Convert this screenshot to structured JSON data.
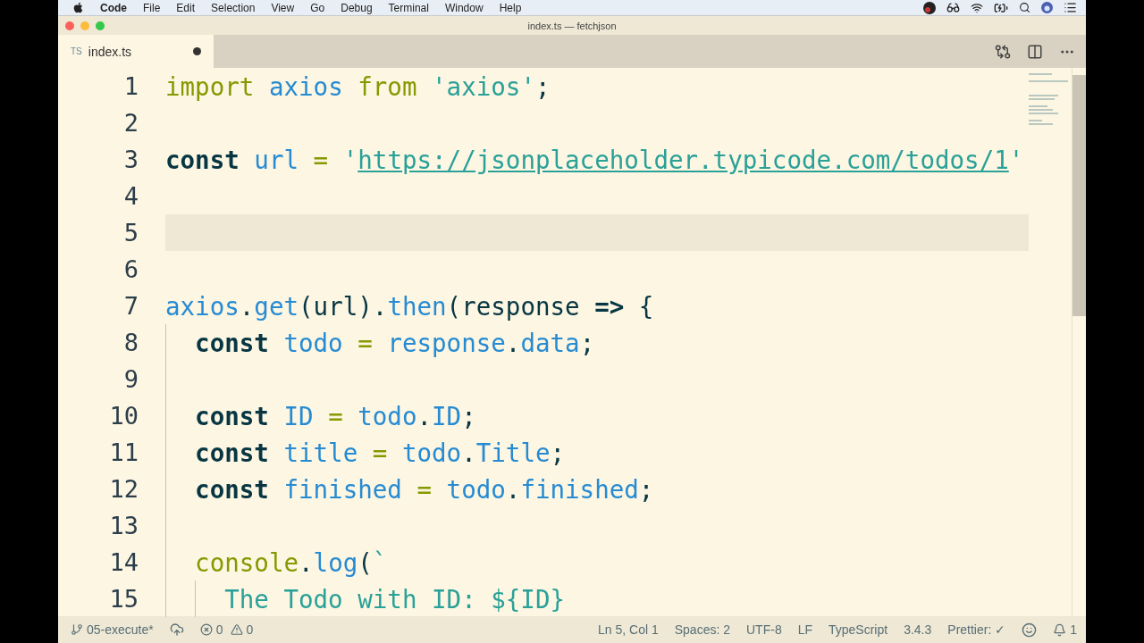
{
  "menubar": {
    "app": "Code",
    "menus": [
      "File",
      "Edit",
      "Selection",
      "View",
      "Go",
      "Debug",
      "Terminal",
      "Window",
      "Help"
    ]
  },
  "window": {
    "title": "index.ts — fetchjson"
  },
  "tabs": [
    {
      "badge": "TS",
      "label": "index.ts",
      "selected": true,
      "modified": true
    }
  ],
  "editor": {
    "lines": [
      {
        "number": "1",
        "highlighted": false,
        "tokens": [
          {
            "kind": "control",
            "text": "import "
          },
          {
            "kind": "variable",
            "text": "axios "
          },
          {
            "kind": "control",
            "text": "from "
          },
          {
            "kind": "string",
            "text": "'axios'"
          },
          {
            "kind": "plain",
            "text": ";"
          }
        ]
      },
      {
        "number": "2",
        "highlighted": false
      },
      {
        "number": "3",
        "highlighted": false,
        "tokens": [
          {
            "kind": "keyword",
            "text": "const "
          },
          {
            "kind": "variable",
            "text": "url "
          },
          {
            "kind": "operator",
            "text": "= "
          },
          {
            "kind": "string",
            "text": "'"
          },
          {
            "kind": "link",
            "text": "https://jsonplaceholder.typicode.com/todos/1"
          },
          {
            "kind": "string",
            "text": "'"
          }
        ]
      },
      {
        "number": "4",
        "highlighted": false
      },
      {
        "number": "5",
        "highlighted": true
      },
      {
        "number": "6",
        "highlighted": false
      },
      {
        "number": "7",
        "highlighted": false,
        "tokens": [
          {
            "kind": "variable",
            "text": "axios"
          },
          {
            "kind": "plain",
            "text": "."
          },
          {
            "kind": "variable",
            "text": "get"
          },
          {
            "kind": "plain",
            "text": "(url)."
          },
          {
            "kind": "variable",
            "text": "then"
          },
          {
            "kind": "plain",
            "text": "(response "
          },
          {
            "kind": "keyword",
            "text": "=> "
          },
          {
            "kind": "plain",
            "text": "{"
          }
        ]
      },
      {
        "number": "8",
        "highlighted": false,
        "tokens": [
          {
            "kind": "keyword",
            "text": "  const "
          },
          {
            "kind": "variable",
            "text": "todo "
          },
          {
            "kind": "operator",
            "text": "= "
          },
          {
            "kind": "variable",
            "text": "response"
          },
          {
            "kind": "plain",
            "text": "."
          },
          {
            "kind": "variable",
            "text": "data"
          },
          {
            "kind": "plain",
            "text": ";"
          }
        ]
      },
      {
        "number": "9",
        "highlighted": false
      },
      {
        "number": "10",
        "highlighted": false,
        "tokens": [
          {
            "kind": "keyword",
            "text": "  const "
          },
          {
            "kind": "variable",
            "text": "ID "
          },
          {
            "kind": "operator",
            "text": "= "
          },
          {
            "kind": "variable",
            "text": "todo"
          },
          {
            "kind": "plain",
            "text": "."
          },
          {
            "kind": "variable",
            "text": "ID"
          },
          {
            "kind": "plain",
            "text": ";"
          }
        ]
      },
      {
        "number": "11",
        "highlighted": false,
        "tokens": [
          {
            "kind": "keyword",
            "text": "  const "
          },
          {
            "kind": "variable",
            "text": "title "
          },
          {
            "kind": "operator",
            "text": "= "
          },
          {
            "kind": "variable",
            "text": "todo"
          },
          {
            "kind": "plain",
            "text": "."
          },
          {
            "kind": "variable",
            "text": "Title"
          },
          {
            "kind": "plain",
            "text": ";"
          }
        ]
      },
      {
        "number": "12",
        "highlighted": false,
        "tokens": [
          {
            "kind": "keyword",
            "text": "  const "
          },
          {
            "kind": "variable",
            "text": "finished "
          },
          {
            "kind": "operator",
            "text": "= "
          },
          {
            "kind": "variable",
            "text": "todo"
          },
          {
            "kind": "plain",
            "text": "."
          },
          {
            "kind": "variable",
            "text": "finished"
          },
          {
            "kind": "plain",
            "text": ";"
          }
        ]
      },
      {
        "number": "13",
        "highlighted": false
      },
      {
        "number": "14",
        "highlighted": false,
        "tokens": [
          {
            "kind": "control",
            "text": "  console"
          },
          {
            "kind": "plain",
            "text": "."
          },
          {
            "kind": "variable",
            "text": "log"
          },
          {
            "kind": "plain",
            "text": "("
          },
          {
            "kind": "string",
            "text": "`"
          }
        ]
      },
      {
        "number": "15",
        "highlighted": false,
        "tokens": [
          {
            "kind": "string",
            "text": "    The Todo with ID: ${ID}"
          }
        ]
      }
    ]
  },
  "status_bar": {
    "left": [
      {
        "kind": "branch",
        "text": "05-execute*"
      },
      {
        "kind": "sync"
      },
      {
        "kind": "problems",
        "errors": "0",
        "warnings": "0"
      }
    ],
    "right": [
      {
        "kind": "text",
        "text": "Ln 5, Col 1"
      },
      {
        "kind": "text",
        "text": "Spaces: 2"
      },
      {
        "kind": "text",
        "text": "UTF-8"
      },
      {
        "kind": "text",
        "text": "LF"
      },
      {
        "kind": "text",
        "text": "TypeScript"
      },
      {
        "kind": "text",
        "text": "3.4.3"
      },
      {
        "kind": "text",
        "text": "Prettier: ✓"
      },
      {
        "kind": "feedback"
      },
      {
        "kind": "notifications",
        "text": "1"
      }
    ]
  }
}
